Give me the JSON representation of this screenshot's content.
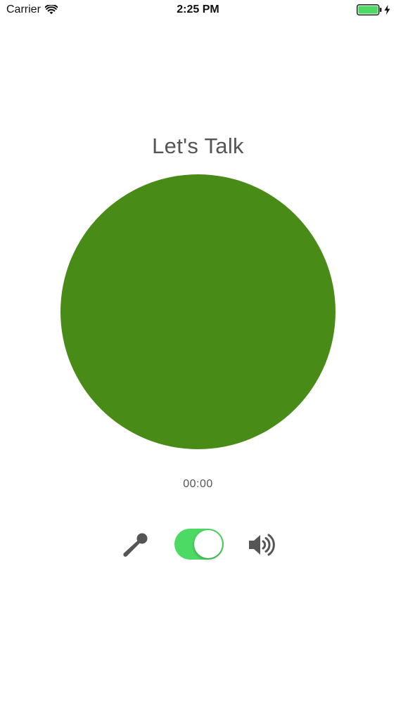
{
  "status_bar": {
    "carrier": "Carrier",
    "time": "2:25 PM",
    "icons": {
      "signal": "wifi-icon",
      "battery": "battery-icon",
      "charging": "bolt-icon"
    },
    "battery_color": "#4cd964"
  },
  "main": {
    "title": "Let's Talk",
    "talk_button_color": "#488b16",
    "timer": "00:00"
  },
  "controls": {
    "mic_icon": "microphone-icon",
    "audio_toggle": {
      "on": true,
      "color": "#4cd964"
    },
    "speaker_icon": "speaker-icon"
  }
}
